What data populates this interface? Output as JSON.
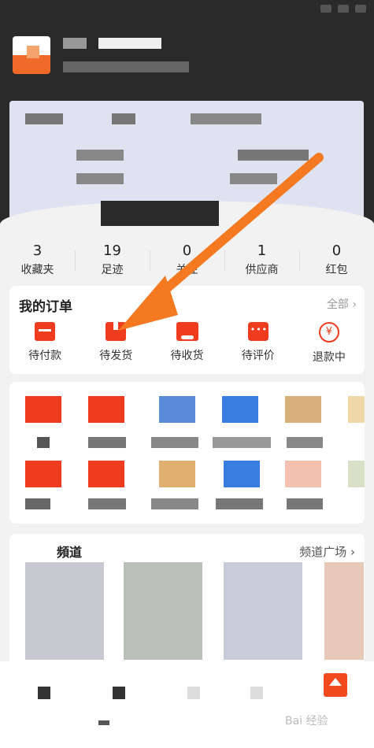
{
  "stats": [
    {
      "num": "3",
      "label": "收藏夹"
    },
    {
      "num": "19",
      "label": "足迹"
    },
    {
      "num": "0",
      "label": "关注"
    },
    {
      "num": "1",
      "label": "供应商"
    },
    {
      "num": "0",
      "label": "红包"
    }
  ],
  "orders": {
    "title": "我的订单",
    "all": "全部 ›",
    "items": [
      {
        "label": "待付款",
        "icon": "wallet-icon"
      },
      {
        "label": "待发货",
        "icon": "box-icon"
      },
      {
        "label": "待收货",
        "icon": "truck-icon"
      },
      {
        "label": "待评价",
        "icon": "chat-icon"
      },
      {
        "label": "退款中",
        "icon": "refund-icon"
      }
    ]
  },
  "channel": {
    "title": "頻道",
    "more": "频道广场 ›"
  },
  "refund_symbol": "¥",
  "watermark": "Bai 经验",
  "colors": {
    "accent": "#f03c1e",
    "arrow": "#f47920",
    "header": "#2a2a2a"
  }
}
